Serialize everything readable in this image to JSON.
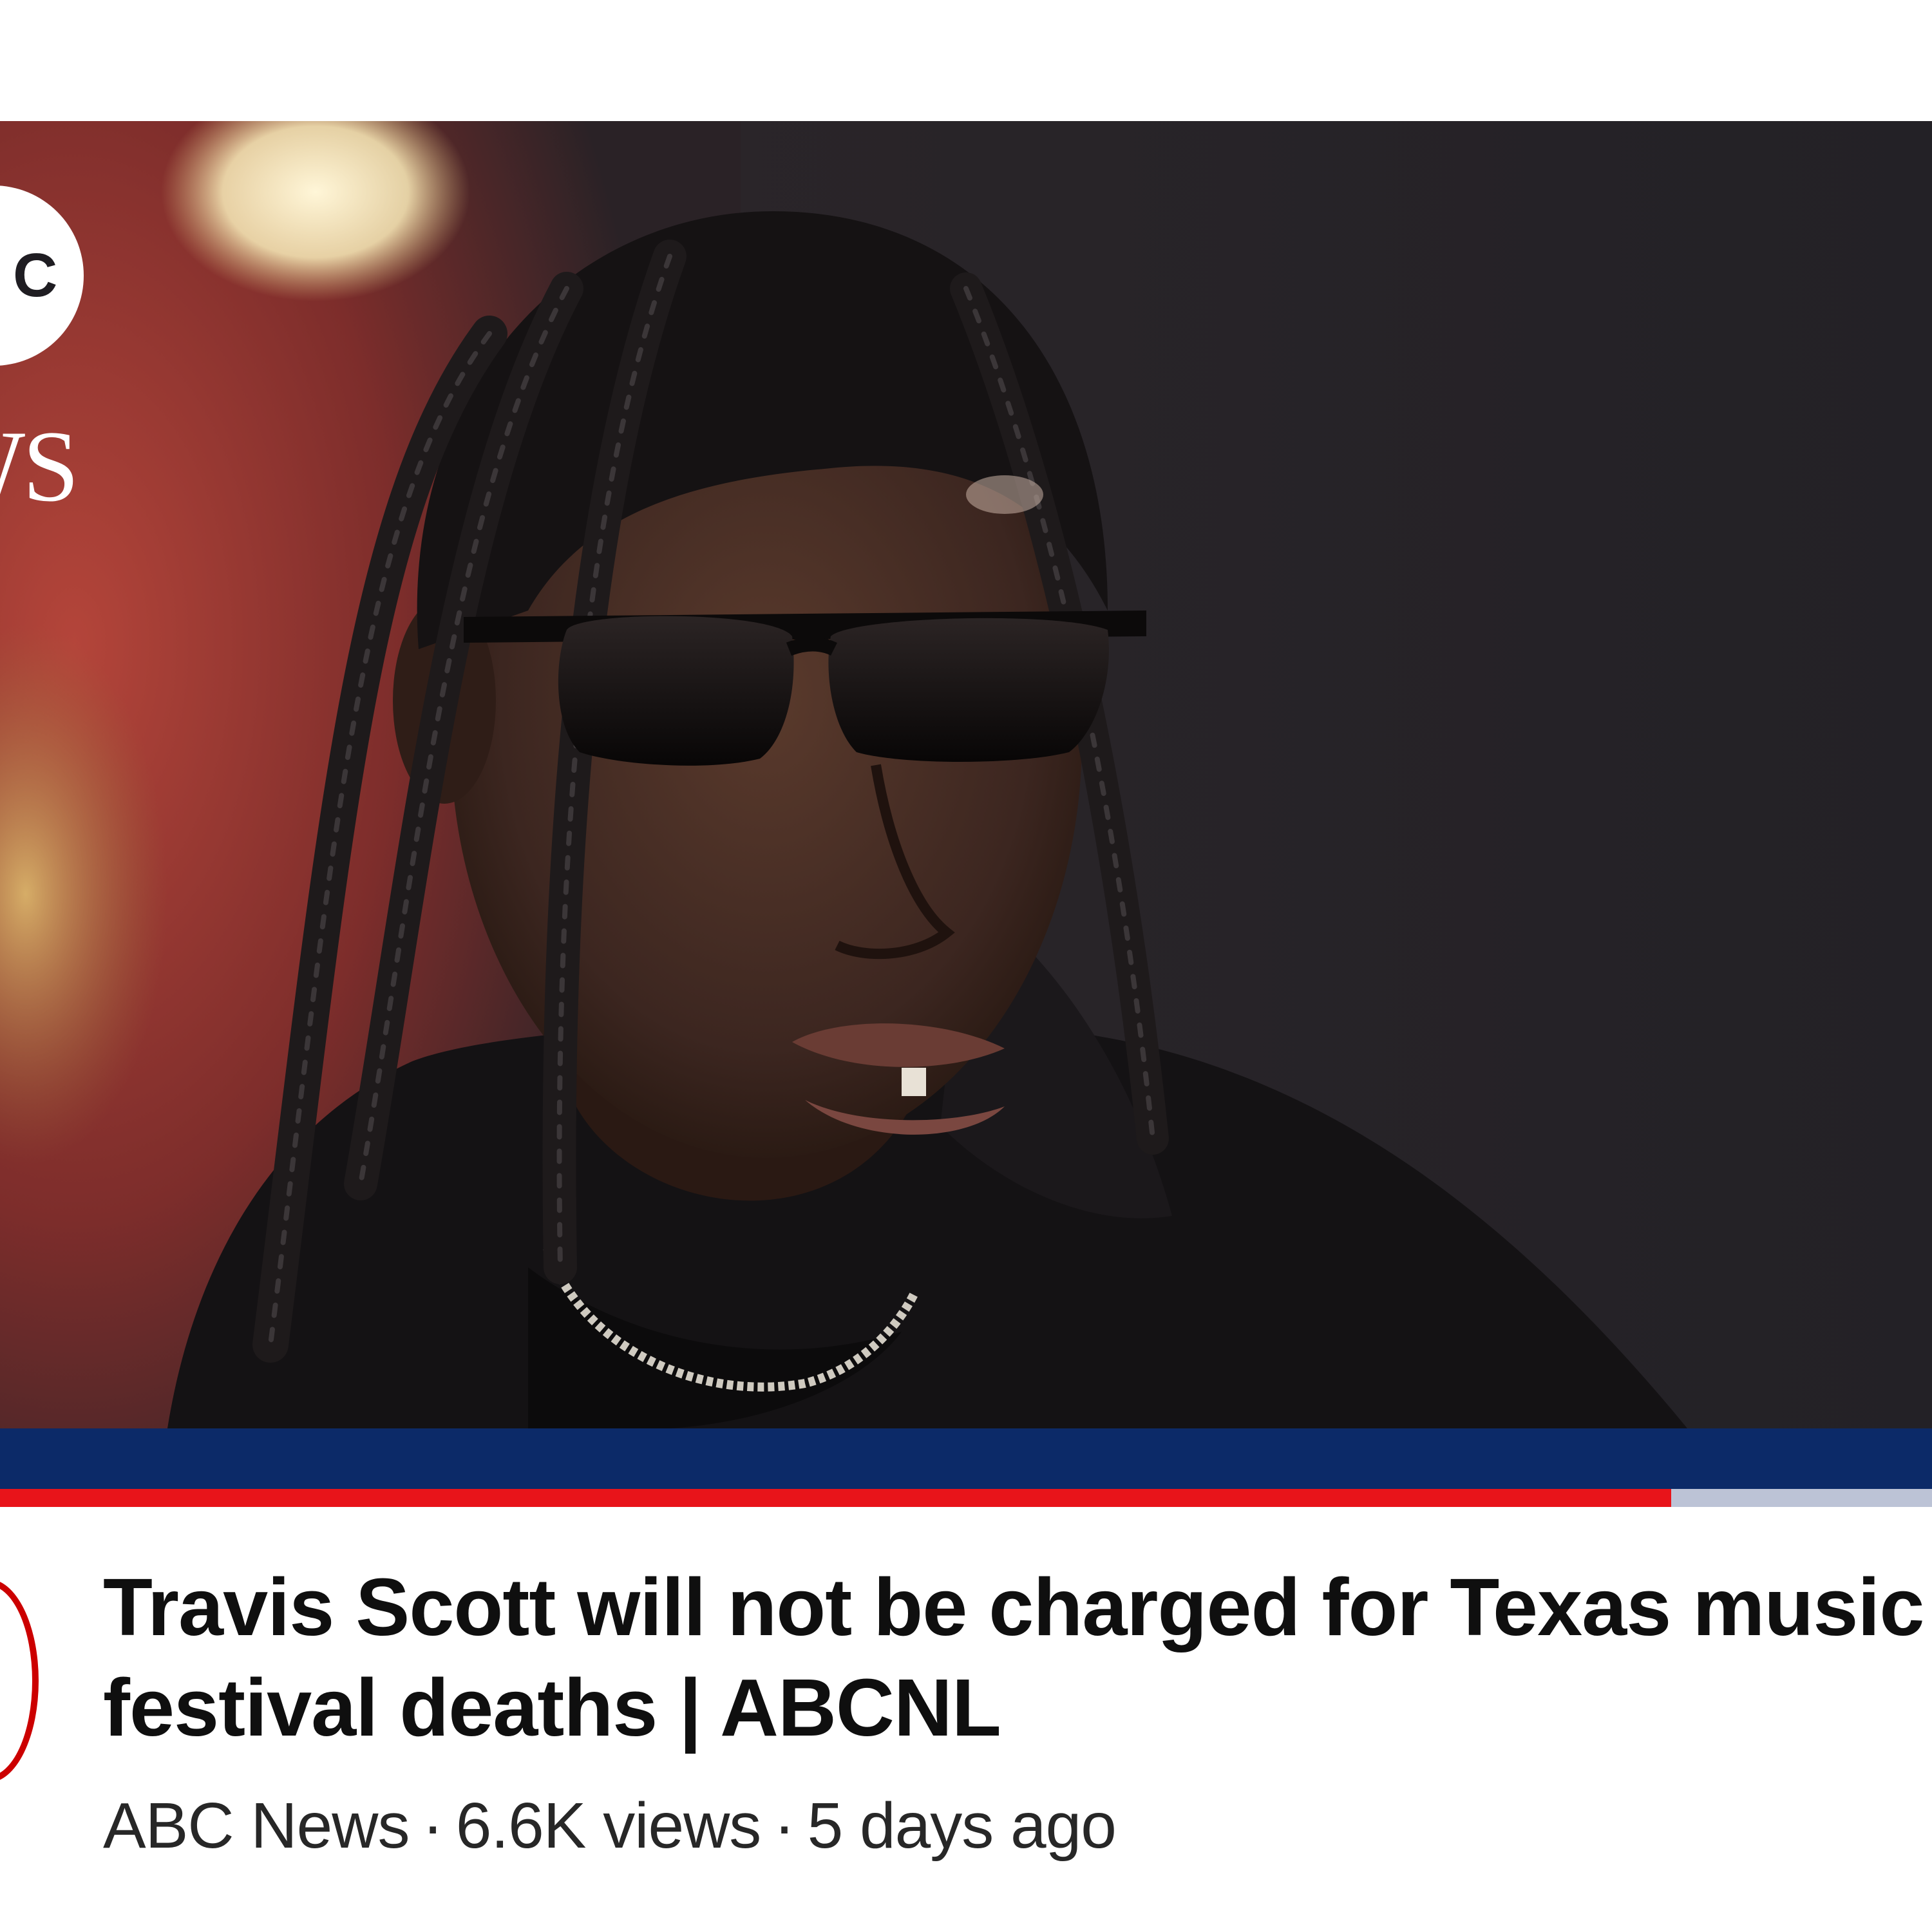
{
  "thumbnail": {
    "logo_letters": "C",
    "logo_word": "WS",
    "progress": 0.865
  },
  "video": {
    "title": "Travis Scott will not be charged for Texas music festival deaths | ABCNL",
    "channel": "ABC News",
    "separator": "·",
    "views": "6.6K views",
    "age": "5 days ago"
  },
  "colors": {
    "band": "#0c2a68",
    "progress_fill": "#e8141a",
    "progress_track": "#bcc3d6",
    "avatar_ring": "#cc0000",
    "title_text": "#0f0f0f",
    "meta_text": "#272727"
  }
}
